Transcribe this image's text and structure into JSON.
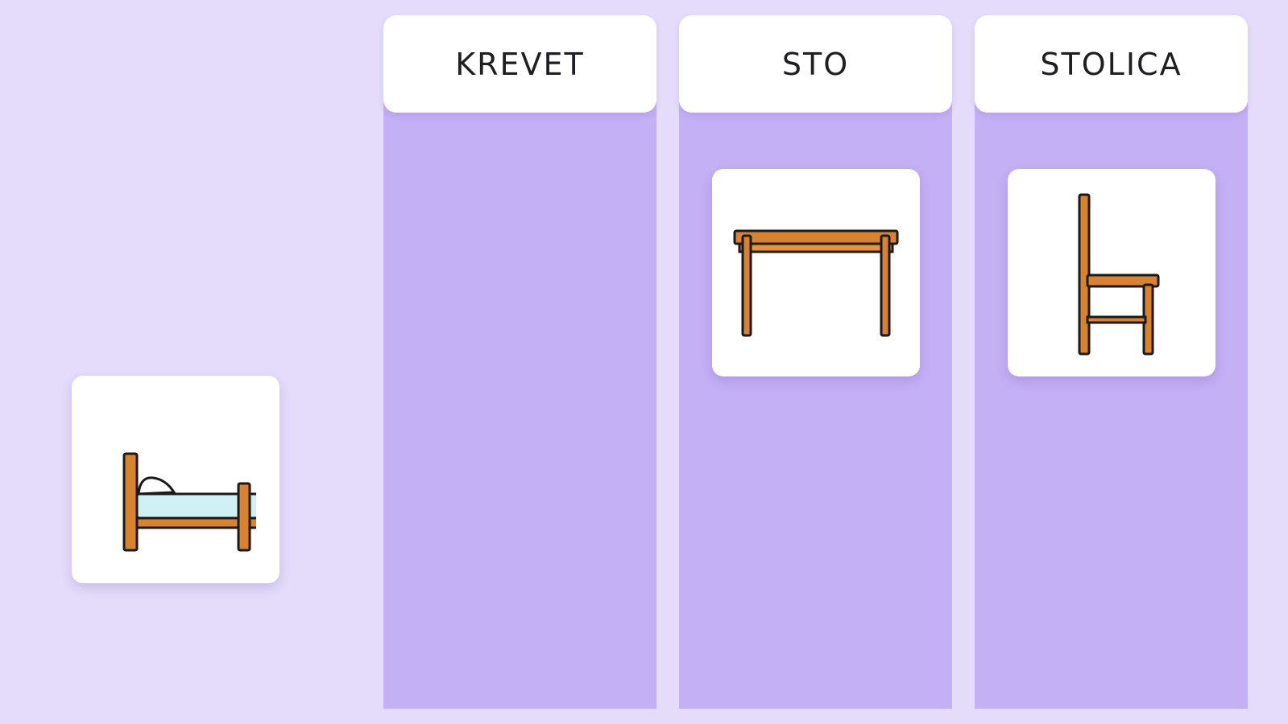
{
  "colors": {
    "background": "#e4dcfa",
    "column_body": "#c4b0f5",
    "card": "#ffffff",
    "header_text": "#1f1f23",
    "wood": "#d9832e",
    "wood_outline": "#1a1a1a",
    "mattress": "#cdf1f4"
  },
  "columns": [
    {
      "label": "KREVET",
      "items": []
    },
    {
      "label": "STO",
      "items": [
        {
          "icon": "table-icon"
        }
      ]
    },
    {
      "label": "STOLICA",
      "items": [
        {
          "icon": "chair-icon"
        }
      ]
    }
  ],
  "unsorted_items": [
    {
      "icon": "bed-icon"
    }
  ]
}
